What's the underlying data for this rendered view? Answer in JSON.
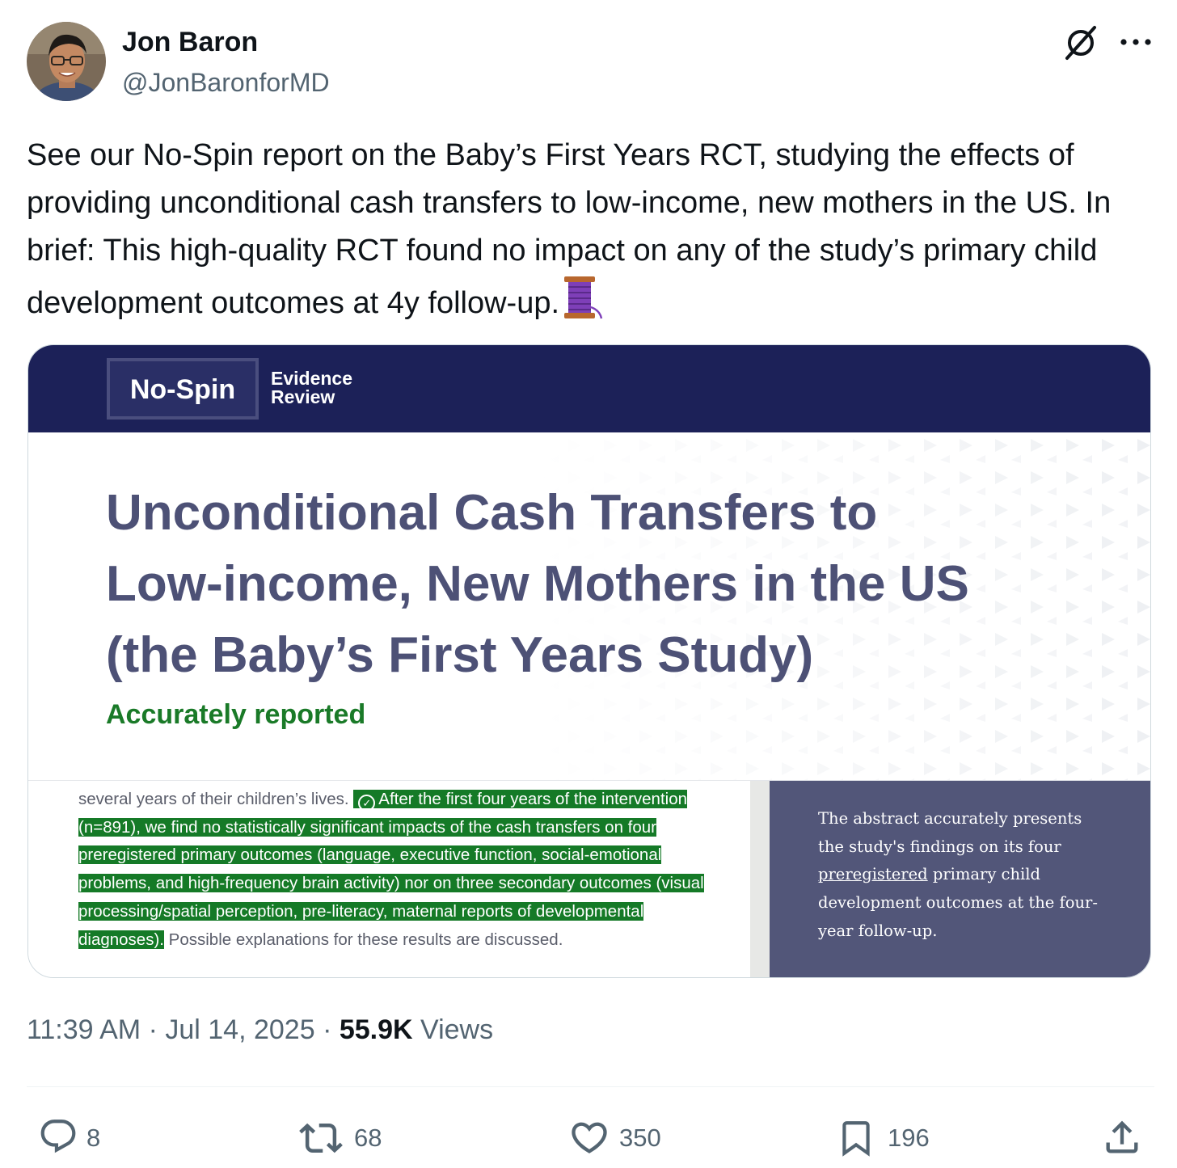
{
  "author": {
    "name": "Jon Baron",
    "handle": "@JonBaronforMD"
  },
  "tweet": {
    "text": "See our No-Spin report on the Baby’s First Years RCT, studying the effects of providing unconditional cash transfers to low-income, new mothers in the US. In brief: This high-quality RCT found no impact on any of the study’s primary child development outcomes at 4y follow-up."
  },
  "card": {
    "brand": "No-Spin",
    "brand_sub_1": "Evidence",
    "brand_sub_2": "Review",
    "title_line_1": "Unconditional Cash Transfers to",
    "title_line_2": "Low-income, New Mothers in the US",
    "title_line_3": "(the Baby’s First Years Study)",
    "status": "Accurately reported",
    "excerpt_before": "several years of their children’s lives. ",
    "excerpt_highlight": "After the first four years of the intervention (n=891), we find no statistically significant impacts of the cash transfers on four preregistered primary outcomes (language, executive function, social-emotional problems, and high-frequency brain activity) nor on three secondary outcomes (visual processing/spatial perception, pre-literacy, maternal reports of developmental diagnoses).",
    "excerpt_after": " Possible explanations for these results are discussed.",
    "verdict_before": "The abstract accurately presents the study's findings on its four ",
    "verdict_underlined": "preregistered",
    "verdict_after": " primary child development outcomes at the four-year follow-up.",
    "colors": {
      "banner": "#1c2158",
      "title": "#4d5176",
      "status": "#1a7a28",
      "highlight": "#157a27",
      "verdict_panel": "#525679"
    }
  },
  "meta": {
    "time": "11:39 AM",
    "dot1": " · ",
    "date": "Jul 14, 2025",
    "dot2": " · ",
    "views_count": "55.9K",
    "views_label": " Views"
  },
  "actions": {
    "replies": "8",
    "reposts": "68",
    "likes": "350",
    "bookmarks": "196"
  },
  "icons": {
    "emoji": "spool-of-thread",
    "grok": "grok-icon",
    "more": "more-icon",
    "reply": "reply-icon",
    "repost": "repost-icon",
    "like": "heart-icon",
    "bookmark": "bookmark-icon",
    "share": "share-icon"
  }
}
